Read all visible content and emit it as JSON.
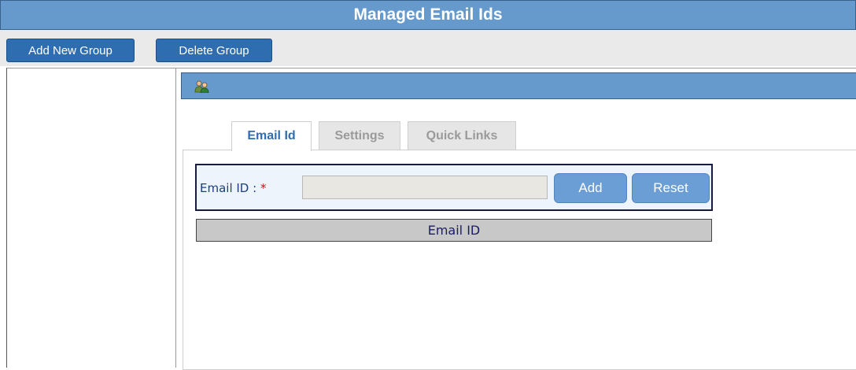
{
  "header": {
    "title": "Managed Email Ids"
  },
  "toolbar": {
    "add_group_label": "Add New Group",
    "delete_group_label": "Delete Group"
  },
  "group_panel": {
    "icon": "users-icon"
  },
  "tabs": [
    {
      "label": "Email Id",
      "active": true
    },
    {
      "label": "Settings",
      "active": false
    },
    {
      "label": "Quick Links",
      "active": false
    }
  ],
  "form": {
    "email_label": "Email ID : ",
    "required_marker": "*",
    "email_value": "",
    "add_label": "Add",
    "reset_label": "Reset"
  },
  "table": {
    "columns": [
      "Email ID"
    ],
    "rows": []
  },
  "colors": {
    "header_bg": "#6699cc",
    "button_bg": "#2e6db0",
    "active_tab_text": "#2e6db0",
    "required": "#d01010"
  }
}
